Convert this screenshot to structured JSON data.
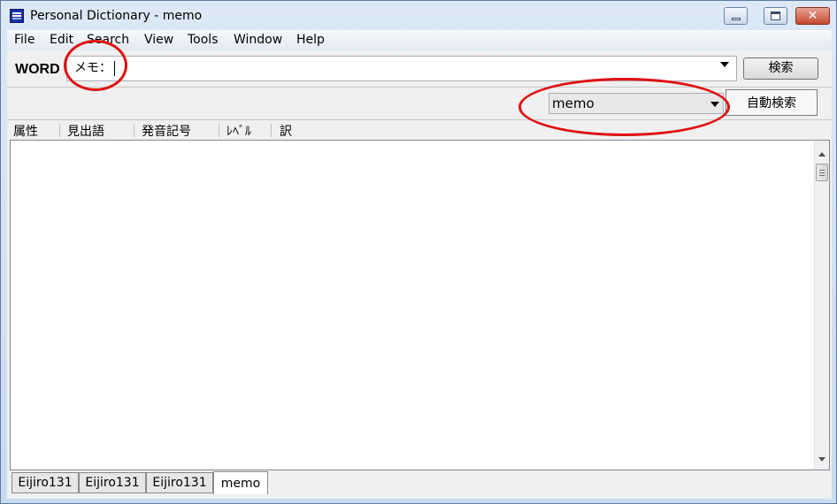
{
  "window": {
    "title": "Personal Dictionary - memo",
    "icon": "app-dictionary-icon",
    "controls": {
      "minimize": "minimize-icon",
      "maximize": "maximize-icon",
      "close": "✕"
    }
  },
  "menubar": {
    "items": [
      "File",
      "Edit",
      "Search",
      "View",
      "Tools",
      "Window",
      "Help"
    ]
  },
  "search": {
    "label": "WORD",
    "value": "メモ：",
    "button_label": "検索"
  },
  "dictionary": {
    "selected": "memo",
    "auto_search_label": "自動検索"
  },
  "columns": [
    "属性",
    "見出語",
    "発音記号",
    "ﾚﾍﾞﾙ",
    "訳"
  ],
  "tabs": [
    {
      "label": "Eijiro131",
      "active": false
    },
    {
      "label": "Eijiro131",
      "active": false
    },
    {
      "label": "Eijiro131",
      "active": false
    },
    {
      "label": "memo",
      "active": true
    }
  ],
  "annotation_color": "#e01010"
}
